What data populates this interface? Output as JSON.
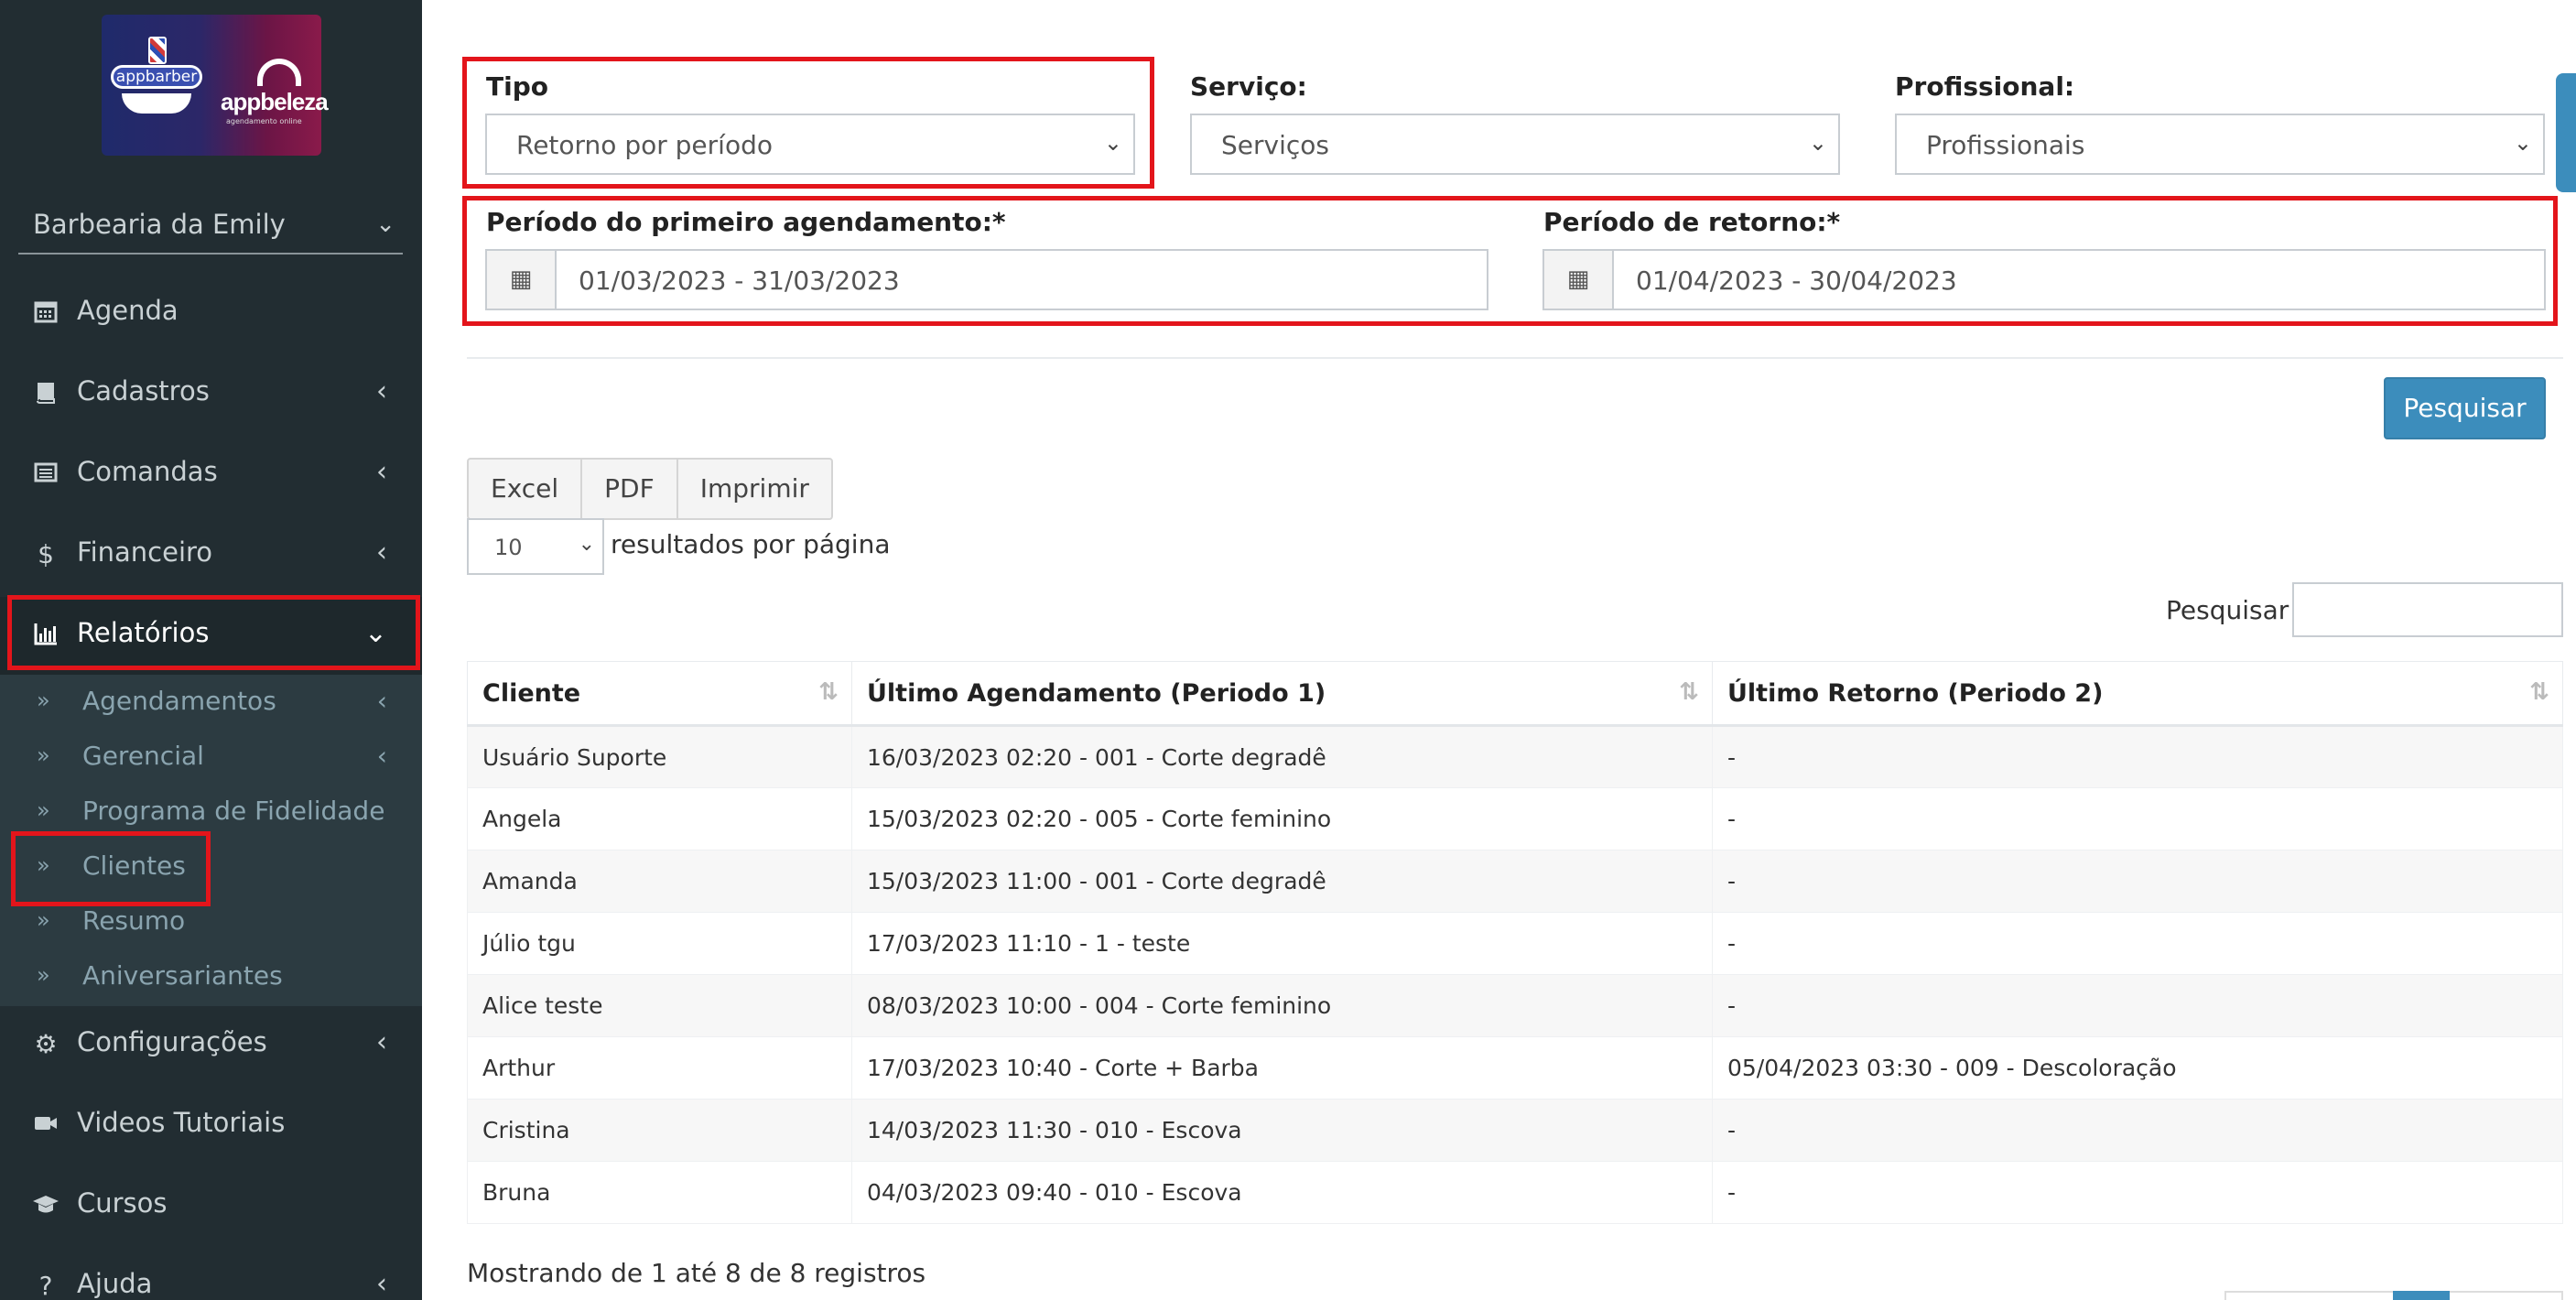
{
  "sidebar": {
    "logo": {
      "brand1": "appbarber",
      "brand2": "appbeleza",
      "brand2_sub": "agendamento online"
    },
    "store": "Barbearia da Emily",
    "menu": {
      "agenda": "Agenda",
      "cadastros": "Cadastros",
      "comandas": "Comandas",
      "financeiro": "Financeiro",
      "relatorios": "Relatórios",
      "configuracoes": "Configurações",
      "videos": "Videos Tutoriais",
      "cursos": "Cursos",
      "ajuda": "Ajuda"
    },
    "submenu": {
      "agendamentos": "Agendamentos",
      "gerencial": "Gerencial",
      "fidelidade": "Programa de Fidelidade",
      "clientes": "Clientes",
      "resumo": "Resumo",
      "aniversariantes": "Aniversariantes"
    }
  },
  "filters": {
    "tipo_label": "Tipo",
    "tipo_value": "Retorno por período",
    "servico_label": "Serviço:",
    "servico_value": "Serviços",
    "profissional_label": "Profissional:",
    "profissional_value": "Profissionais",
    "periodo1_label": "Período do primeiro agendamento:*",
    "periodo1_value": "01/03/2023 - 31/03/2023",
    "periodo2_label": "Período de retorno:*",
    "periodo2_value": "01/04/2023 - 30/04/2023",
    "search_button": "Pesquisar"
  },
  "toolbar": {
    "excel": "Excel",
    "pdf": "PDF",
    "print": "Imprimir",
    "page_size": "10",
    "page_size_label": "resultados por página",
    "search_label": "Pesquisar"
  },
  "table": {
    "headers": [
      "Cliente",
      "Último Agendamento (Periodo 1)",
      "Último Retorno (Periodo 2)"
    ],
    "rows": [
      [
        "Usuário Suporte",
        "16/03/2023 02:20 - 001 - Corte degradê",
        "-"
      ],
      [
        "Angela",
        "15/03/2023 02:20 - 005 - Corte feminino",
        "-"
      ],
      [
        "Amanda",
        "15/03/2023 11:00 - 001 - Corte degradê",
        "-"
      ],
      [
        "Júlio tgu",
        "17/03/2023 11:10 - 1 - teste",
        "-"
      ],
      [
        "Alice teste",
        "08/03/2023 10:00 - 004 - Corte feminino",
        "-"
      ],
      [
        "Arthur",
        "17/03/2023 10:40 - Corte + Barba",
        "05/04/2023 03:30 - 009 - Descoloração"
      ],
      [
        "Cristina",
        "14/03/2023 11:30 - 010 - Escova",
        "-"
      ],
      [
        "Bruna",
        "04/03/2023 09:40 - 010 - Escova",
        "-"
      ]
    ]
  },
  "footer": {
    "info": "Mostrando de 1 até 8 de 8 registros"
  },
  "colors": {
    "sidebar_bg": "#222d32",
    "submenu_bg": "#2c3b41",
    "primary": "#3c8dbc",
    "highlight_box": "#e3151b"
  }
}
